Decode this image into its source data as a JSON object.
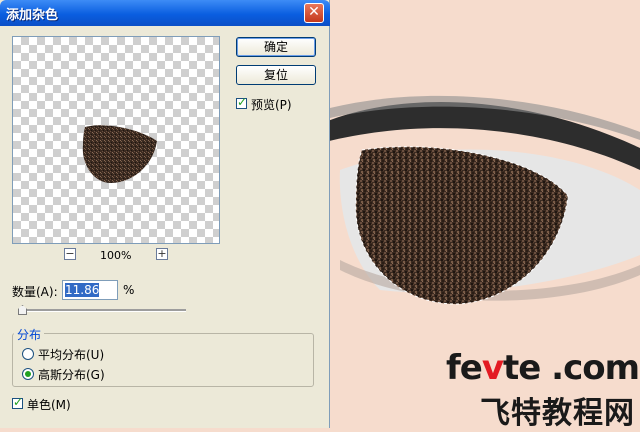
{
  "dialog": {
    "title": "添加杂色",
    "close_glyph": "✕",
    "ok_label": "确定",
    "reset_label": "复位",
    "preview_label": "预览(P)",
    "preview_checked": true,
    "zoom_out_glyph": "−",
    "zoom_in_glyph": "+",
    "zoom_level": "100%",
    "amount_label": "数量(A):",
    "amount_value": "11.86",
    "amount_unit": "%",
    "distribution": {
      "label": "分布",
      "options": [
        {
          "label": "平均分布(U)",
          "selected": false
        },
        {
          "label": "高斯分布(G)",
          "selected": true
        }
      ]
    },
    "monochrome_label": "单色(M)",
    "monochrome_checked": true
  },
  "watermark": {
    "site_prefix": "fe",
    "site_accent": "v",
    "site_suffix": "te .com",
    "brand": "飞特教程网"
  },
  "colors": {
    "canvas_skin": "#f6dccd",
    "noise_dark": "#3a2a20",
    "titlebar": "#0a5ee0",
    "dialog_bg": "#ece9d8",
    "checkmark": "#21a121",
    "watermark_accent": "#e31b23"
  },
  "icons": {
    "close": "close-icon",
    "checkbox": "check-icon",
    "slider": "slider-thumb-icon"
  }
}
